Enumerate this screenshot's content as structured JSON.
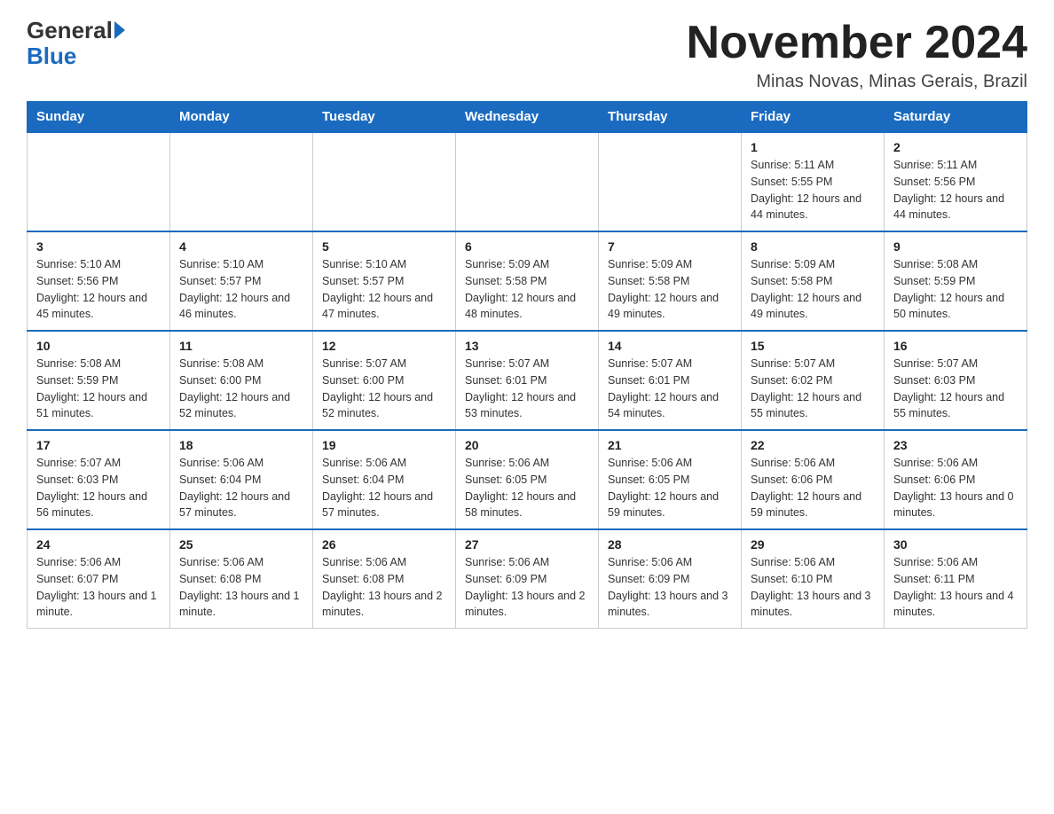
{
  "logo": {
    "text_general": "General",
    "text_blue": "Blue"
  },
  "header": {
    "title": "November 2024",
    "subtitle": "Minas Novas, Minas Gerais, Brazil"
  },
  "weekdays": [
    "Sunday",
    "Monday",
    "Tuesday",
    "Wednesday",
    "Thursday",
    "Friday",
    "Saturday"
  ],
  "weeks": [
    [
      {
        "day": "",
        "info": ""
      },
      {
        "day": "",
        "info": ""
      },
      {
        "day": "",
        "info": ""
      },
      {
        "day": "",
        "info": ""
      },
      {
        "day": "",
        "info": ""
      },
      {
        "day": "1",
        "info": "Sunrise: 5:11 AM\nSunset: 5:55 PM\nDaylight: 12 hours and 44 minutes."
      },
      {
        "day": "2",
        "info": "Sunrise: 5:11 AM\nSunset: 5:56 PM\nDaylight: 12 hours and 44 minutes."
      }
    ],
    [
      {
        "day": "3",
        "info": "Sunrise: 5:10 AM\nSunset: 5:56 PM\nDaylight: 12 hours and 45 minutes."
      },
      {
        "day": "4",
        "info": "Sunrise: 5:10 AM\nSunset: 5:57 PM\nDaylight: 12 hours and 46 minutes."
      },
      {
        "day": "5",
        "info": "Sunrise: 5:10 AM\nSunset: 5:57 PM\nDaylight: 12 hours and 47 minutes."
      },
      {
        "day": "6",
        "info": "Sunrise: 5:09 AM\nSunset: 5:58 PM\nDaylight: 12 hours and 48 minutes."
      },
      {
        "day": "7",
        "info": "Sunrise: 5:09 AM\nSunset: 5:58 PM\nDaylight: 12 hours and 49 minutes."
      },
      {
        "day": "8",
        "info": "Sunrise: 5:09 AM\nSunset: 5:58 PM\nDaylight: 12 hours and 49 minutes."
      },
      {
        "day": "9",
        "info": "Sunrise: 5:08 AM\nSunset: 5:59 PM\nDaylight: 12 hours and 50 minutes."
      }
    ],
    [
      {
        "day": "10",
        "info": "Sunrise: 5:08 AM\nSunset: 5:59 PM\nDaylight: 12 hours and 51 minutes."
      },
      {
        "day": "11",
        "info": "Sunrise: 5:08 AM\nSunset: 6:00 PM\nDaylight: 12 hours and 52 minutes."
      },
      {
        "day": "12",
        "info": "Sunrise: 5:07 AM\nSunset: 6:00 PM\nDaylight: 12 hours and 52 minutes."
      },
      {
        "day": "13",
        "info": "Sunrise: 5:07 AM\nSunset: 6:01 PM\nDaylight: 12 hours and 53 minutes."
      },
      {
        "day": "14",
        "info": "Sunrise: 5:07 AM\nSunset: 6:01 PM\nDaylight: 12 hours and 54 minutes."
      },
      {
        "day": "15",
        "info": "Sunrise: 5:07 AM\nSunset: 6:02 PM\nDaylight: 12 hours and 55 minutes."
      },
      {
        "day": "16",
        "info": "Sunrise: 5:07 AM\nSunset: 6:03 PM\nDaylight: 12 hours and 55 minutes."
      }
    ],
    [
      {
        "day": "17",
        "info": "Sunrise: 5:07 AM\nSunset: 6:03 PM\nDaylight: 12 hours and 56 minutes."
      },
      {
        "day": "18",
        "info": "Sunrise: 5:06 AM\nSunset: 6:04 PM\nDaylight: 12 hours and 57 minutes."
      },
      {
        "day": "19",
        "info": "Sunrise: 5:06 AM\nSunset: 6:04 PM\nDaylight: 12 hours and 57 minutes."
      },
      {
        "day": "20",
        "info": "Sunrise: 5:06 AM\nSunset: 6:05 PM\nDaylight: 12 hours and 58 minutes."
      },
      {
        "day": "21",
        "info": "Sunrise: 5:06 AM\nSunset: 6:05 PM\nDaylight: 12 hours and 59 minutes."
      },
      {
        "day": "22",
        "info": "Sunrise: 5:06 AM\nSunset: 6:06 PM\nDaylight: 12 hours and 59 minutes."
      },
      {
        "day": "23",
        "info": "Sunrise: 5:06 AM\nSunset: 6:06 PM\nDaylight: 13 hours and 0 minutes."
      }
    ],
    [
      {
        "day": "24",
        "info": "Sunrise: 5:06 AM\nSunset: 6:07 PM\nDaylight: 13 hours and 1 minute."
      },
      {
        "day": "25",
        "info": "Sunrise: 5:06 AM\nSunset: 6:08 PM\nDaylight: 13 hours and 1 minute."
      },
      {
        "day": "26",
        "info": "Sunrise: 5:06 AM\nSunset: 6:08 PM\nDaylight: 13 hours and 2 minutes."
      },
      {
        "day": "27",
        "info": "Sunrise: 5:06 AM\nSunset: 6:09 PM\nDaylight: 13 hours and 2 minutes."
      },
      {
        "day": "28",
        "info": "Sunrise: 5:06 AM\nSunset: 6:09 PM\nDaylight: 13 hours and 3 minutes."
      },
      {
        "day": "29",
        "info": "Sunrise: 5:06 AM\nSunset: 6:10 PM\nDaylight: 13 hours and 3 minutes."
      },
      {
        "day": "30",
        "info": "Sunrise: 5:06 AM\nSunset: 6:11 PM\nDaylight: 13 hours and 4 minutes."
      }
    ]
  ]
}
